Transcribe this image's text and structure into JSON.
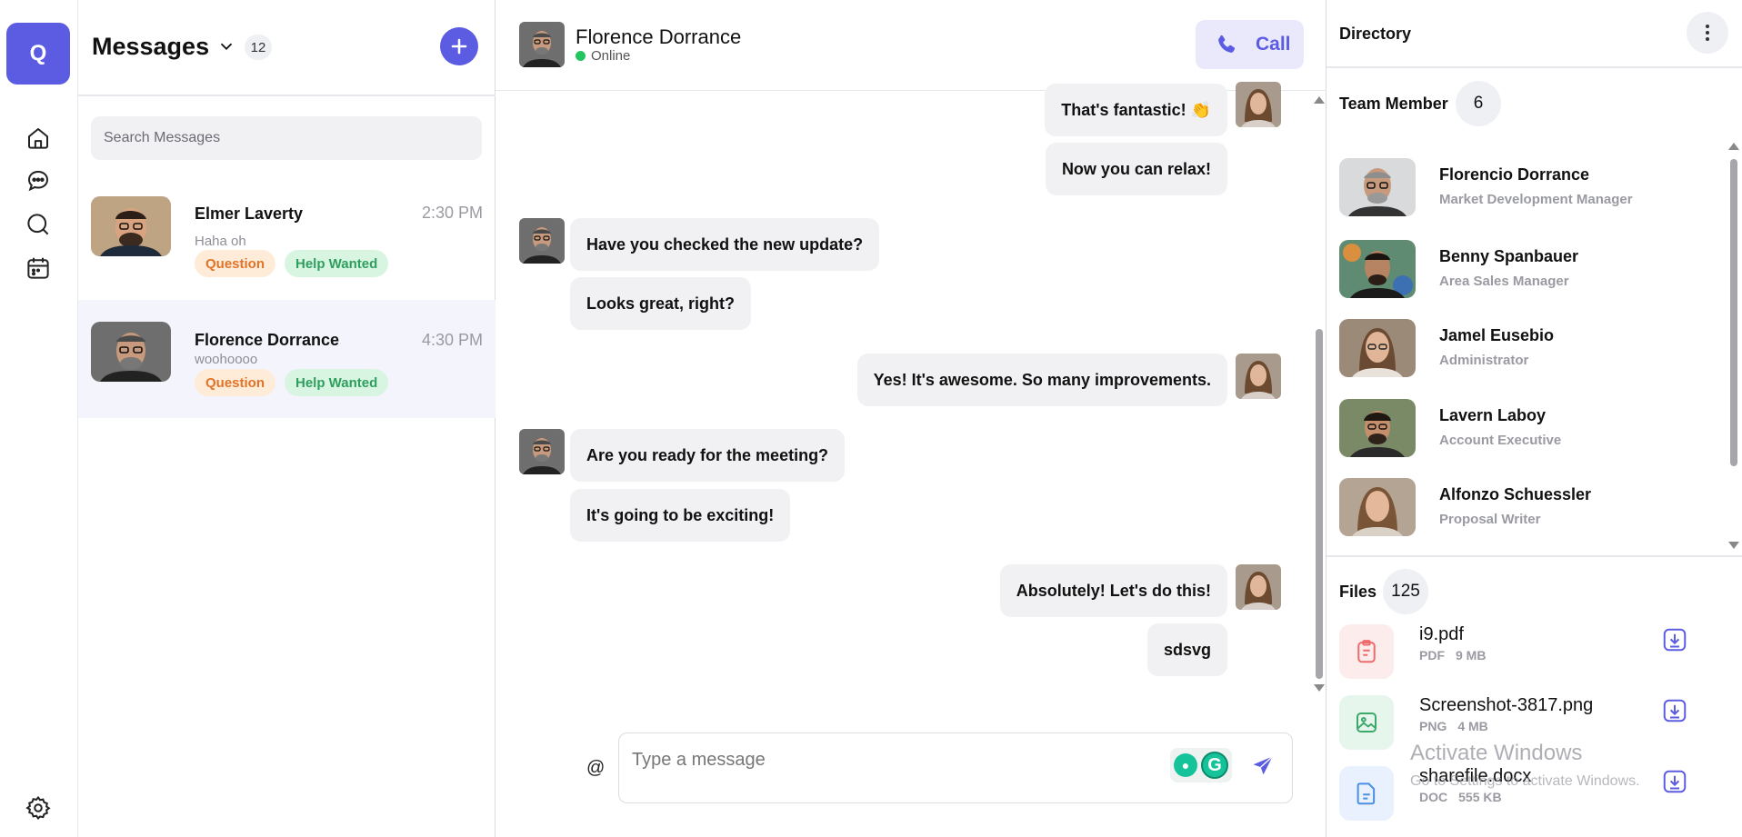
{
  "sidebar": {
    "logo_letter": "Q",
    "icons": [
      "home-icon",
      "chat-icon",
      "search-icon",
      "calendar-icon",
      "gear-icon"
    ]
  },
  "conversations": {
    "title": "Messages",
    "count": "12",
    "search_placeholder": "Search Messages",
    "items": [
      {
        "name": "Elmer Laverty",
        "time": "2:30 PM",
        "preview": "Haha oh",
        "tags": [
          "Question",
          "Help Wanted"
        ]
      },
      {
        "name": "Florence Dorrance",
        "time": "4:30 PM",
        "preview": "woohoooo",
        "tags": [
          "Question",
          "Help Wanted"
        ]
      }
    ]
  },
  "chat": {
    "contact_name": "Florence Dorrance",
    "contact_status": "Online",
    "call_label": "Call",
    "messages": [
      {
        "from": "me",
        "text": "That's fantastic! 👏"
      },
      {
        "from": "me",
        "text": "Now you can relax!"
      },
      {
        "from": "them",
        "text": "Have you checked the new update?"
      },
      {
        "from": "them",
        "text": "Looks great, right?"
      },
      {
        "from": "me",
        "text": "Yes! It's awesome. So many improvements."
      },
      {
        "from": "them",
        "text": "Are you ready for the meeting?"
      },
      {
        "from": "them",
        "text": "It's going to be exciting!"
      },
      {
        "from": "me",
        "text": "Absolutely! Let's do this!"
      },
      {
        "from": "me",
        "text": "sdsvg"
      }
    ],
    "mention_symbol": "@",
    "composer_placeholder": "Type a message"
  },
  "directory": {
    "title": "Directory",
    "team_title": "Team Member",
    "team_count": "6",
    "members": [
      {
        "name": "Florencio Dorrance",
        "role": "Market Development Manager"
      },
      {
        "name": "Benny Spanbauer",
        "role": "Area Sales Manager"
      },
      {
        "name": "Jamel Eusebio",
        "role": "Administrator"
      },
      {
        "name": "Lavern Laboy",
        "role": "Account Executive"
      },
      {
        "name": "Alfonzo Schuessler",
        "role": "Proposal Writer"
      }
    ],
    "files_title": "Files",
    "files_count": "125",
    "files": [
      {
        "name": "i9.pdf",
        "type": "PDF",
        "size": "9 MB",
        "color": "#ef6b6b"
      },
      {
        "name": "Screenshot-3817.png",
        "type": "PNG",
        "size": "4 MB",
        "color": "#3aaa6a"
      },
      {
        "name": "sharefile.docx",
        "type": "DOC",
        "size": "555 KB",
        "color": "#4a8fe0"
      }
    ]
  },
  "watermark": {
    "line1": "Activate Windows",
    "line2": "Go to Settings to activate Windows."
  },
  "colors": {
    "accent": "#5b5ce2",
    "online": "#22c55e",
    "tag_question_bg": "#feecd9",
    "tag_question_fg": "#e0742a",
    "tag_help_bg": "#d8f5e2",
    "tag_help_fg": "#2f9e5e"
  }
}
